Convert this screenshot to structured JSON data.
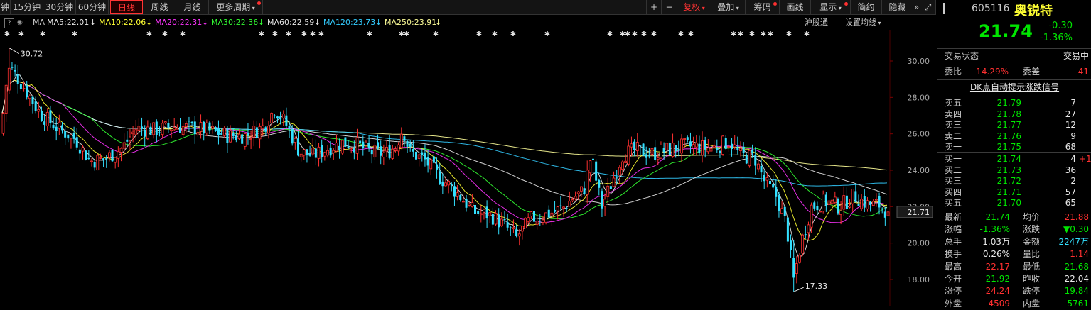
{
  "toolbar": {
    "left_tabs": [
      "钟",
      "15分钟",
      "30分钟",
      "60分钟",
      "日线",
      "周线",
      "月线",
      "更多周期"
    ],
    "active_tab": "日线",
    "right_buttons": [
      "+",
      "−",
      "复权",
      "叠加",
      "筹码",
      "画线",
      "显示",
      "简约",
      "隐藏"
    ],
    "window_icons": [
      "»",
      "⤢"
    ]
  },
  "ma_legend": {
    "help": "?",
    "ma_label": "MA",
    "items": [
      {
        "text": "MA5:22.01",
        "arrow": "↓",
        "color": "#e8e8e8"
      },
      {
        "text": "MA10:22.06",
        "arrow": "↓",
        "color": "#ffff33"
      },
      {
        "text": "MA20:22.31",
        "arrow": "↓",
        "color": "#ff33ff"
      },
      {
        "text": "MA30:22.36",
        "arrow": "↓",
        "color": "#33ff33"
      },
      {
        "text": "MA60:22.59",
        "arrow": "↓",
        "color": "#e8e8e8"
      },
      {
        "text": "MA120:23.73",
        "arrow": "↓",
        "color": "#33ccff"
      },
      {
        "text": "MA250:23.91",
        "arrow": "↓",
        "color": "#ffff99"
      }
    ],
    "right_links": [
      "沪股通",
      "设置均线"
    ]
  },
  "axis": {
    "ticks": [
      "30.00",
      "28.00",
      "26.00",
      "24.00",
      "22.00",
      "20.00",
      "18.00"
    ],
    "current_price": "21.71",
    "high_label": "30.72",
    "low_label": "17.33"
  },
  "colors": {
    "up": "#ff3030",
    "down": "#33e0ff",
    "ma5": "#e8e8e8",
    "ma10": "#ffff33",
    "ma20": "#ff33ff",
    "ma30": "#33ff33",
    "ma60": "#e8e8e8",
    "ma120": "#33ccff",
    "ma250": "#ffff99"
  },
  "chart_data": {
    "type": "candlestick",
    "title": "",
    "ylim": [
      17.0,
      31.5
    ],
    "high": 30.72,
    "low": 17.33,
    "last": 21.71,
    "close_path": [
      [
        0,
        26.0
      ],
      [
        10,
        29.8
      ],
      [
        30,
        28.7
      ],
      [
        55,
        27.1
      ],
      [
        80,
        26.3
      ],
      [
        105,
        25.7
      ],
      [
        125,
        24.5
      ],
      [
        145,
        24.6
      ],
      [
        170,
        25.2
      ],
      [
        190,
        26.3
      ],
      [
        215,
        26.2
      ],
      [
        245,
        26.4
      ],
      [
        275,
        26.3
      ],
      [
        300,
        26.1
      ],
      [
        320,
        25.9
      ],
      [
        345,
        25.9
      ],
      [
        370,
        26.4
      ],
      [
        385,
        27.4
      ],
      [
        400,
        26.6
      ],
      [
        420,
        25.0
      ],
      [
        440,
        24.8
      ],
      [
        460,
        25.2
      ],
      [
        480,
        25.5
      ],
      [
        500,
        25.4
      ],
      [
        520,
        25.0
      ],
      [
        540,
        24.9
      ],
      [
        555,
        25.3
      ],
      [
        565,
        26.3
      ],
      [
        575,
        25.0
      ],
      [
        595,
        24.6
      ],
      [
        615,
        23.7
      ],
      [
        635,
        23.0
      ],
      [
        650,
        22.4
      ],
      [
        665,
        21.7
      ],
      [
        690,
        21.5
      ],
      [
        710,
        20.9
      ],
      [
        725,
        20.3
      ],
      [
        745,
        21.3
      ],
      [
        770,
        21.6
      ],
      [
        790,
        21.9
      ],
      [
        805,
        22.5
      ],
      [
        820,
        22.9
      ],
      [
        830,
        24.8
      ],
      [
        845,
        22.0
      ],
      [
        860,
        23.4
      ],
      [
        875,
        24.9
      ],
      [
        895,
        25.1
      ],
      [
        915,
        24.9
      ],
      [
        935,
        25.1
      ],
      [
        955,
        25.3
      ],
      [
        975,
        25.3
      ],
      [
        1000,
        25.2
      ],
      [
        1025,
        25.6
      ],
      [
        1040,
        24.8
      ],
      [
        1060,
        24.7
      ],
      [
        1075,
        23.3
      ],
      [
        1090,
        22.6
      ],
      [
        1105,
        21.0
      ],
      [
        1115,
        18.0
      ],
      [
        1125,
        19.9
      ],
      [
        1140,
        22.0
      ],
      [
        1160,
        22.3
      ],
      [
        1180,
        22.0
      ],
      [
        1200,
        22.6
      ],
      [
        1220,
        22.1
      ],
      [
        1235,
        22.1
      ],
      [
        1248,
        21.71
      ]
    ]
  },
  "panel": {
    "code": "605116",
    "name": "奥锐特",
    "price": "21.74",
    "change": "-0.30",
    "change_pct": "-1.36%",
    "status_label": "交易状态",
    "status_value": "交易中",
    "weibi_label": "委比",
    "weibi_value": "14.29%",
    "weicha_label": "委差",
    "weicha_value": "41",
    "dk_link": "DK点自动提示涨跌信号",
    "asks": [
      {
        "label": "卖五",
        "price": "21.79",
        "vol": "7"
      },
      {
        "label": "卖四",
        "price": "21.78",
        "vol": "27"
      },
      {
        "label": "卖三",
        "price": "21.77",
        "vol": "12"
      },
      {
        "label": "卖二",
        "price": "21.76",
        "vol": "9"
      },
      {
        "label": "卖一",
        "price": "21.75",
        "vol": "68"
      }
    ],
    "bids": [
      {
        "label": "买一",
        "price": "21.74",
        "vol": "4",
        "delta": "+1"
      },
      {
        "label": "买二",
        "price": "21.73",
        "vol": "36",
        "delta": ""
      },
      {
        "label": "买三",
        "price": "21.72",
        "vol": "2",
        "delta": ""
      },
      {
        "label": "买四",
        "price": "21.71",
        "vol": "57",
        "delta": ""
      },
      {
        "label": "买五",
        "price": "21.70",
        "vol": "65",
        "delta": ""
      }
    ],
    "stats": [
      {
        "l1": "最新",
        "v1": "21.74",
        "c1": "green",
        "l2": "均价",
        "v2": "21.88",
        "c2": "red"
      },
      {
        "l1": "涨幅",
        "v1": "-1.36%",
        "c1": "green",
        "l2": "涨跌",
        "v2": "▼0.30",
        "c2": "green"
      },
      {
        "l1": "总手",
        "v1": "1.03万",
        "c1": "white",
        "l2": "金额",
        "v2": "2247万",
        "c2": "cyan"
      },
      {
        "l1": "换手",
        "v1": "0.26%",
        "c1": "white",
        "l2": "量比",
        "v2": "1.14",
        "c2": "red"
      },
      {
        "l1": "最高",
        "v1": "22.17",
        "c1": "red",
        "l2": "最低",
        "v2": "21.68",
        "c2": "green"
      },
      {
        "l1": "今开",
        "v1": "21.92",
        "c1": "green",
        "l2": "昨收",
        "v2": "22.04",
        "c2": "white"
      },
      {
        "l1": "涨停",
        "v1": "24.24",
        "c1": "red",
        "l2": "跌停",
        "v2": "19.84",
        "c2": "green"
      },
      {
        "l1": "外盘",
        "v1": "4509",
        "c1": "red",
        "l2": "内盘",
        "v2": "5761",
        "c2": "green"
      }
    ]
  }
}
